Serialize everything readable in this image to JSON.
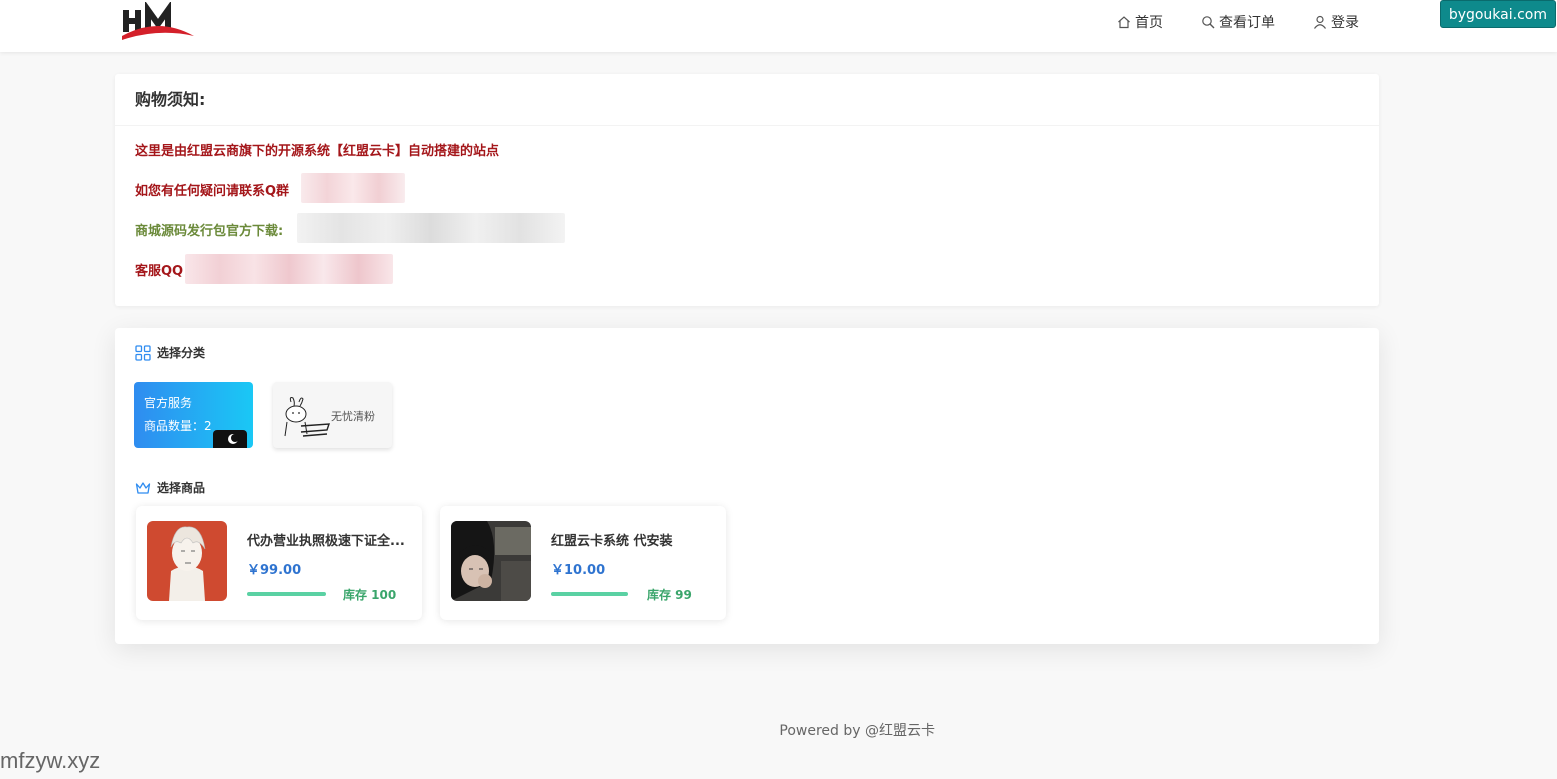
{
  "header": {
    "nav": [
      {
        "label": "首页",
        "icon": "home-icon"
      },
      {
        "label": "查看订单",
        "icon": "search-icon"
      },
      {
        "label": "登录",
        "icon": "user-icon"
      }
    ],
    "badge": "bygoukai.com"
  },
  "notice": {
    "title": "购物须知:",
    "line1": "这里是由红盟云商旗下的开源系统【红盟云卡】自动搭建的站点",
    "line2": "如您有任何疑问请联系Q群",
    "line3": "商城源码发行包官方下载:",
    "line4": "客服QQ"
  },
  "categories": {
    "title": "选择分类",
    "items": [
      {
        "name": "官方服务",
        "count_label": "商品数量：2"
      },
      {
        "name": "无忧清粉"
      }
    ]
  },
  "products": {
    "title": "选择商品",
    "items": [
      {
        "name": "代办营业执照极速下证全...",
        "price": "￥99.00",
        "stock": "库存 100"
      },
      {
        "name": "红盟云卡系统 代安装",
        "price": "￥10.00",
        "stock": "库存 99"
      }
    ]
  },
  "footer": {
    "powered": "Powered by @红盟云卡"
  },
  "watermark": "mfzyw.xyz",
  "colors": {
    "accent": "#2f74d0",
    "notice_red": "#a4161a",
    "notice_green": "#6b8a3a",
    "stock_green": "#3aa56b",
    "badge": "#0e8a8c"
  }
}
